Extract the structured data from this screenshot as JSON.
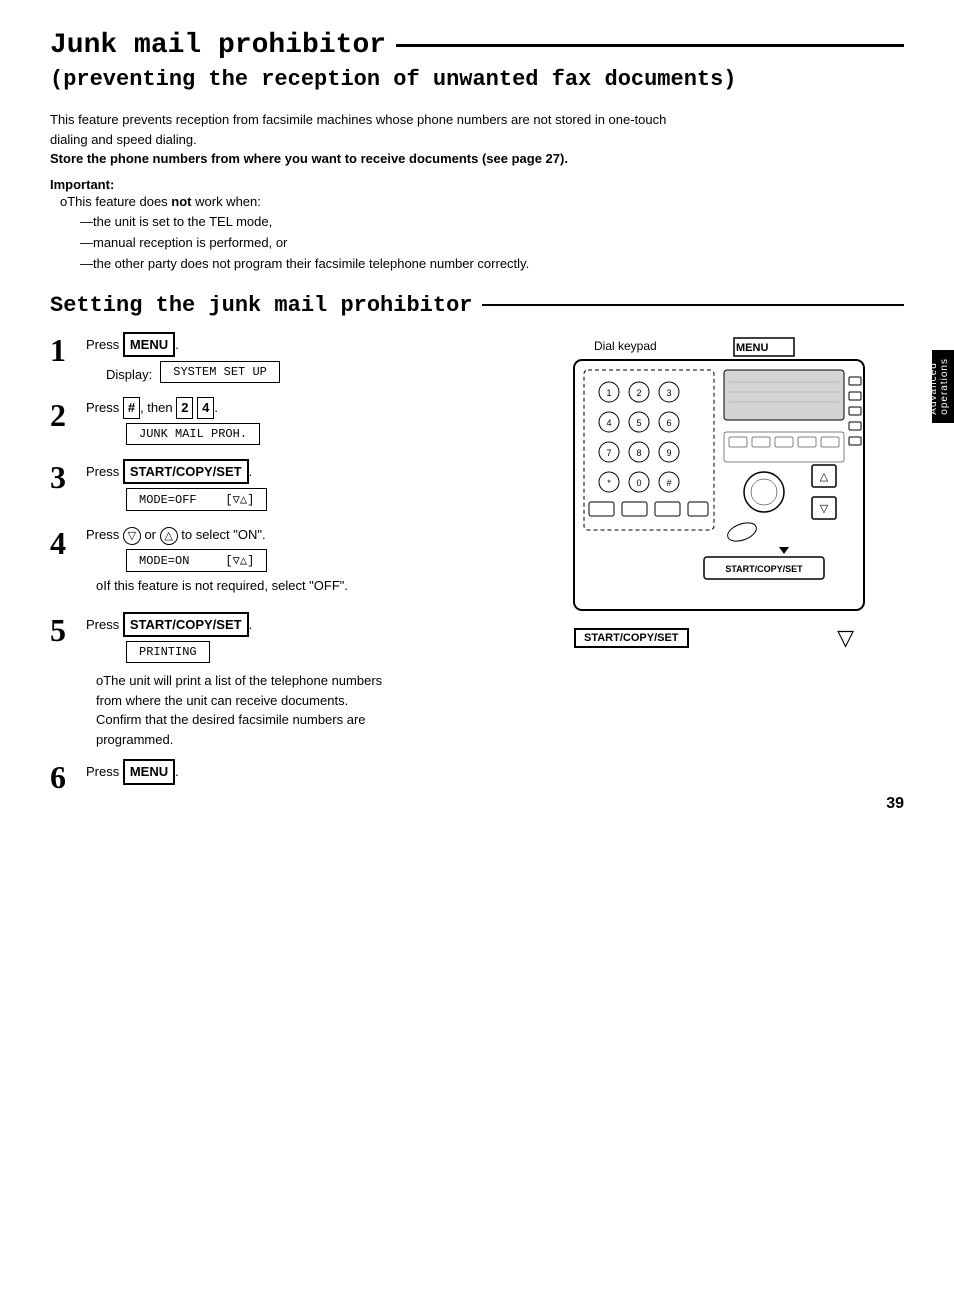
{
  "page": {
    "title_main": "Junk mail prohibitor",
    "title_sub": "(preventing the reception of unwanted fax documents)",
    "intro_line1": "This feature prevents reception from facsimile machines whose phone numbers are not stored in one-touch",
    "intro_line2": "dialing and speed dialing.",
    "intro_bold": "Store the phone numbers from where you want to receive documents (see page 27).",
    "important_label": "Important:",
    "important_note": "oThis feature does ",
    "important_note_bold": "not",
    "important_note_end": " work when:",
    "dash1": "—the unit is set to the TEL mode,",
    "dash2": "—manual reception is performed, or",
    "dash3": "—the other party does not program their facsimile telephone number correctly.",
    "section_heading": "Setting the junk mail prohibitor",
    "steps": [
      {
        "number": "1",
        "instruction": "Press MENU.",
        "display": "SYSTEM SET UP",
        "display_label": "Display:"
      },
      {
        "number": "2",
        "instruction": "Press #, then 2 4.",
        "display": "JUNK MAIL PROH."
      },
      {
        "number": "3",
        "instruction": "Press START/COPY/SET.",
        "display": "MODE=OFF    [∇△]"
      },
      {
        "number": "4",
        "instruction": "Press ▽ or △ to select \"ON\".",
        "display": "MODE=ON     [∇△]",
        "note": "oIf this feature is not required, select \"OFF\"."
      },
      {
        "number": "5",
        "instruction": "Press START/COPY/SET.",
        "display": "PRINTING",
        "note1": "oThe unit will print a list of the telephone numbers",
        "note2": "from where the unit can receive documents.",
        "note3": "Confirm that the desired facsimile numbers are",
        "note4": "programmed."
      },
      {
        "number": "6",
        "instruction": "Press MENU."
      }
    ],
    "diagram_label_keypad": "Dial keypad",
    "diagram_label_menu": "MENU",
    "diagram_label_start": "START/COPY/SET",
    "page_number": "39",
    "side_tab_line1": "Advanced",
    "side_tab_line2": "operations"
  }
}
